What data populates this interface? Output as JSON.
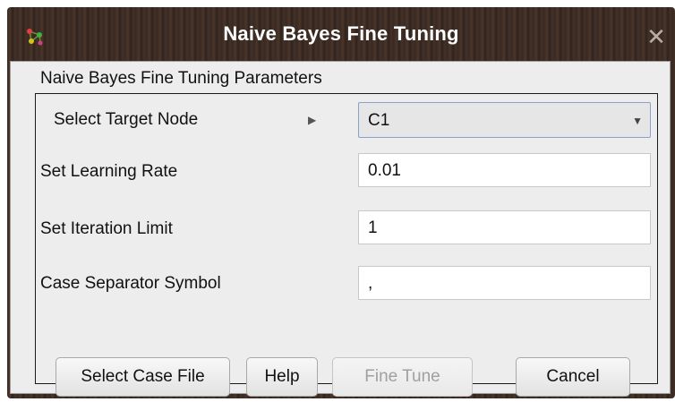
{
  "window": {
    "title": "Naive Bayes Fine Tuning",
    "close_symbol": "✕",
    "app_icon": "network-graph-icon"
  },
  "panel": {
    "title": "Naive Bayes Fine Tuning Parameters"
  },
  "fields": {
    "target_node": {
      "label": "Select Target Node",
      "value": "C1"
    },
    "learning_rate": {
      "label": "Set Learning Rate",
      "value": "0.01"
    },
    "iteration_limit": {
      "label": "Set Iteration Limit",
      "value": "1"
    },
    "case_separator": {
      "label": "Case Separator Symbol",
      "value": ","
    }
  },
  "buttons": {
    "select_case_file": "Select Case File",
    "help": "Help",
    "fine_tune": "Fine Tune",
    "cancel": "Cancel"
  }
}
